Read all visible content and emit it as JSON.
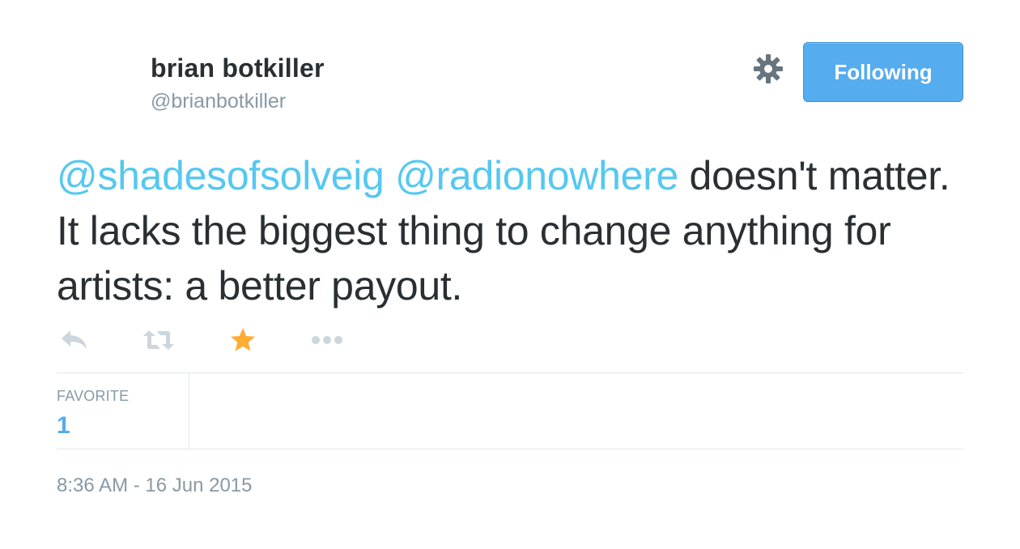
{
  "user": {
    "display_name": "brian botkiller",
    "screen_name": "@brianbotkiller"
  },
  "header": {
    "follow_button_label": "Following",
    "settings_icon": "gear-icon"
  },
  "tweet": {
    "mention_1": "@shadesofsolveig",
    "mention_2": "@radionowhere",
    "text": " doesn't matter. It lacks the biggest thing to change anything for artists: a better payout."
  },
  "actions": {
    "reply_icon": "reply-icon",
    "retweet_icon": "retweet-icon",
    "favorite_icon": "star-icon",
    "more_icon": "more-icon",
    "favorite_active_color": "#ffac33",
    "inactive_color": "#ccd6dd"
  },
  "stats": {
    "favorites_label": "FAVORITE",
    "favorites_count": "1"
  },
  "timestamp": "8:36 AM - 16 Jun 2015",
  "colors": {
    "accent": "#55acee",
    "mention": "#55c8f0",
    "secondary_text": "#8899a6",
    "primary_text": "#292f33"
  }
}
